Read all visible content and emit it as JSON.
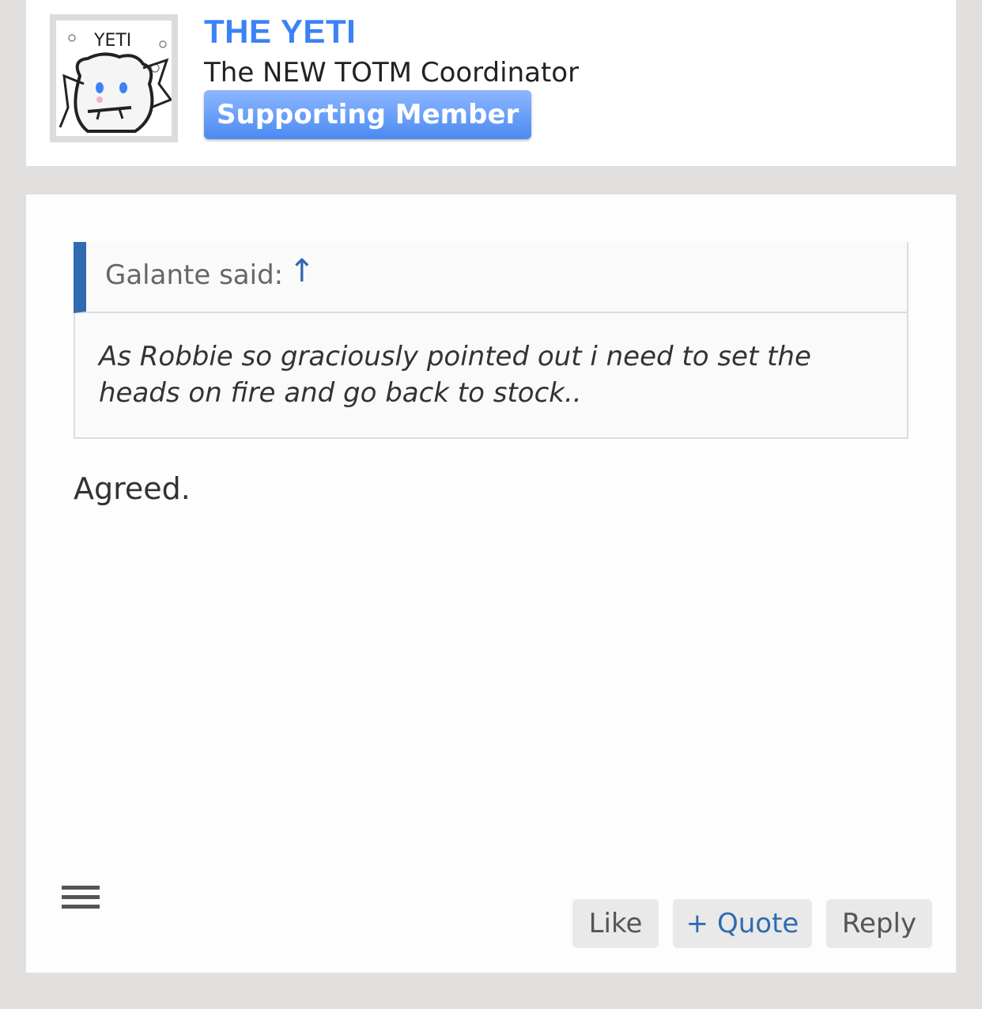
{
  "user": {
    "avatar_icon": "yeti-avatar-icon",
    "avatar_text": "YETI",
    "name": "THE YETI",
    "title": "The NEW TOTM Coordinator",
    "badge": "Supporting Member"
  },
  "quote": {
    "author": "Galante said:",
    "jump_icon": "↑",
    "text": "As Robbie so graciously pointed out i need to set the heads on fire and go back to stock.."
  },
  "post": {
    "text": "Agreed."
  },
  "actions": {
    "menu_icon": "hamburger-icon",
    "like": "Like",
    "quote": "+ Quote",
    "reply": "Reply"
  },
  "colors": {
    "accent": "#3b82f6",
    "quote_bar": "#2f6bb0",
    "background": "#e2e0df"
  }
}
